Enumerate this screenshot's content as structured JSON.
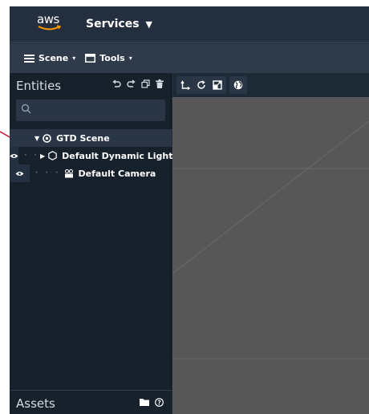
{
  "header": {
    "logo_text": "aws",
    "services_label": "Services",
    "services_caret": "▼"
  },
  "menubar": {
    "scene_label": "Scene",
    "tools_label": "Tools",
    "caret": "▾"
  },
  "entities_panel": {
    "title": "Entities",
    "tools": [
      "undo-icon",
      "redo-icon",
      "duplicate-icon",
      "delete-icon"
    ],
    "search_placeholder": "",
    "tree": [
      {
        "label": "GTD Scene",
        "icon": "scene-target-icon",
        "expanded": true,
        "level": 0
      },
      {
        "label": "Default Dynamic Light",
        "icon": "hexagon-light-icon",
        "expanded": false,
        "level": 1
      },
      {
        "label": "Default Camera",
        "icon": "camera-icon",
        "level": 1
      }
    ]
  },
  "assets_panel": {
    "title": "Assets",
    "tools": [
      "folder-icon",
      "help-icon"
    ]
  },
  "viewport": {
    "toolbar": [
      "translate-icon",
      "rotate-icon",
      "scale-icon",
      "globe-icon"
    ],
    "background_color": "#575757"
  },
  "annotation": {
    "color": "#c8102e"
  }
}
